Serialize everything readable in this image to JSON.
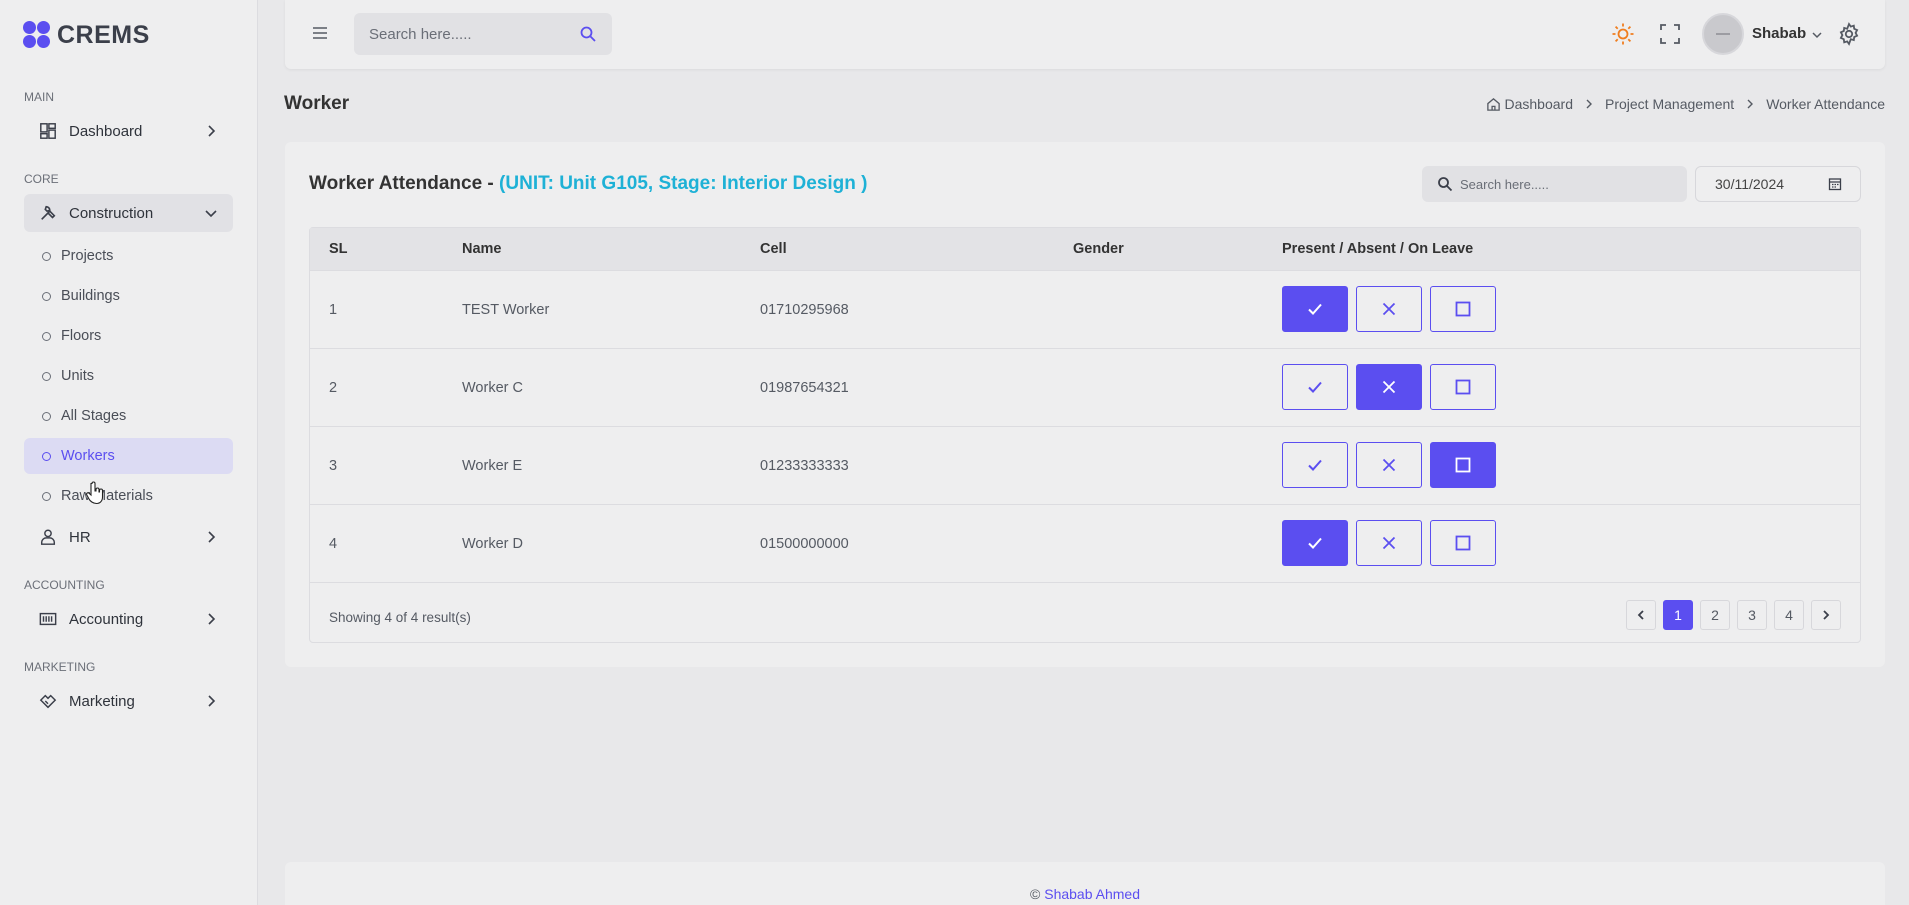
{
  "app": {
    "name": "CREMS",
    "accent_color": "#5b4ef0",
    "highlight_color": "#1eb1d6"
  },
  "sidebar": {
    "categories": {
      "main": "MAIN",
      "core": "CORE",
      "accounting": "ACCOUNTING",
      "marketing": "MARKETING"
    },
    "dashboard": "Dashboard",
    "construction": "Construction",
    "construction_items": [
      "Projects",
      "Buildings",
      "Floors",
      "Units",
      "All Stages",
      "Workers",
      "Raw Materials"
    ],
    "active_item": "Workers",
    "hr": "HR",
    "accounting": "Accounting",
    "marketing": "Marketing"
  },
  "header": {
    "search_placeholder": "Search here.....",
    "user_name": "Shabab"
  },
  "page": {
    "title": "Worker",
    "breadcrumb": [
      "Dashboard",
      "Project Management",
      "Worker Attendance"
    ]
  },
  "card": {
    "title": "Worker Attendance - ",
    "title_highlight": "(UNIT: Unit G105, Stage: Interior Design )",
    "search_placeholder": "Search here.....",
    "date": "30/11/2024",
    "columns": {
      "sl": "SL",
      "name": "Name",
      "cell": "Cell",
      "gender": "Gender",
      "status": "Present / Absent / On Leave"
    },
    "rows": [
      {
        "sl": "1",
        "name": "TEST Worker",
        "cell": "01710295968",
        "gender": "",
        "status": "present"
      },
      {
        "sl": "2",
        "name": "Worker C",
        "cell": "01987654321",
        "gender": "",
        "status": "absent"
      },
      {
        "sl": "3",
        "name": "Worker E",
        "cell": "01233333333",
        "gender": "",
        "status": "leave"
      },
      {
        "sl": "4",
        "name": "Worker D",
        "cell": "01500000000",
        "gender": "",
        "status": "present"
      }
    ],
    "showing": "Showing 4 of 4 result(s)",
    "pages": [
      "1",
      "2",
      "3",
      "4"
    ],
    "current_page": "1"
  },
  "footer": {
    "copyright": "©",
    "author": "Shabab Ahmed"
  }
}
